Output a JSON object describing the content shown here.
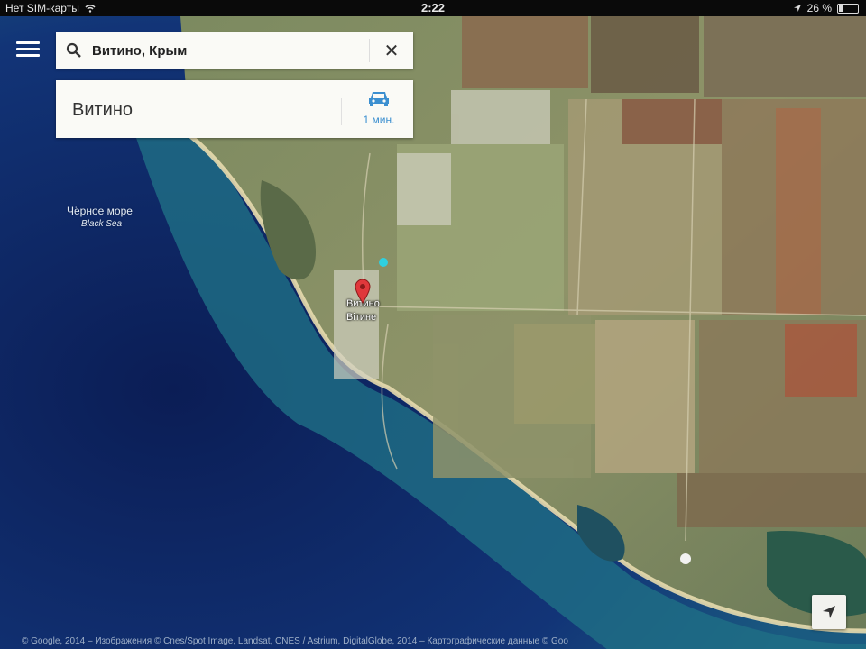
{
  "status_bar": {
    "carrier": "Нет SIM-карты",
    "time": "2:22",
    "battery": "26 %",
    "battery_level": 0.26,
    "icons": [
      "wifi-icon",
      "location-arrow-icon",
      "battery-icon"
    ]
  },
  "search": {
    "query": "Витино, Крым",
    "icons": [
      "menu-icon",
      "search-icon",
      "close-icon"
    ]
  },
  "result": {
    "title": "Витино",
    "route_time": "1 мин.",
    "route_icon": "car-icon",
    "route_color": "#3b8fd0"
  },
  "map": {
    "sea_label_ru": "Чёрное море",
    "sea_label_en": "Black Sea",
    "town_label_ru": "Витино",
    "town_label_ua": "Вітине",
    "pin_color": "#e0383b",
    "sea_color": "#0f2b6e",
    "locate_icon": "navigation-arrow-icon",
    "attribution": "© Google, 2014 – Изображения © Cnes/Spot Image, Landsat, CNES / Astrium, DigitalGlobe, 2014 – Картографические данные © Goo"
  }
}
